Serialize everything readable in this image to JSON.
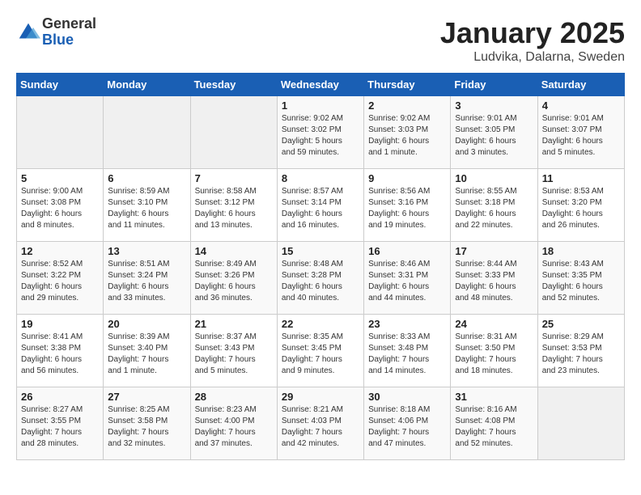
{
  "app": {
    "name_general": "General",
    "name_blue": "Blue"
  },
  "calendar": {
    "title": "January 2025",
    "subtitle": "Ludvika, Dalarna, Sweden"
  },
  "headers": [
    "Sunday",
    "Monday",
    "Tuesday",
    "Wednesday",
    "Thursday",
    "Friday",
    "Saturday"
  ],
  "weeks": [
    [
      {
        "day": "",
        "info": ""
      },
      {
        "day": "",
        "info": ""
      },
      {
        "day": "",
        "info": ""
      },
      {
        "day": "1",
        "info": "Sunrise: 9:02 AM\nSunset: 3:02 PM\nDaylight: 5 hours\nand 59 minutes."
      },
      {
        "day": "2",
        "info": "Sunrise: 9:02 AM\nSunset: 3:03 PM\nDaylight: 6 hours\nand 1 minute."
      },
      {
        "day": "3",
        "info": "Sunrise: 9:01 AM\nSunset: 3:05 PM\nDaylight: 6 hours\nand 3 minutes."
      },
      {
        "day": "4",
        "info": "Sunrise: 9:01 AM\nSunset: 3:07 PM\nDaylight: 6 hours\nand 5 minutes."
      }
    ],
    [
      {
        "day": "5",
        "info": "Sunrise: 9:00 AM\nSunset: 3:08 PM\nDaylight: 6 hours\nand 8 minutes."
      },
      {
        "day": "6",
        "info": "Sunrise: 8:59 AM\nSunset: 3:10 PM\nDaylight: 6 hours\nand 11 minutes."
      },
      {
        "day": "7",
        "info": "Sunrise: 8:58 AM\nSunset: 3:12 PM\nDaylight: 6 hours\nand 13 minutes."
      },
      {
        "day": "8",
        "info": "Sunrise: 8:57 AM\nSunset: 3:14 PM\nDaylight: 6 hours\nand 16 minutes."
      },
      {
        "day": "9",
        "info": "Sunrise: 8:56 AM\nSunset: 3:16 PM\nDaylight: 6 hours\nand 19 minutes."
      },
      {
        "day": "10",
        "info": "Sunrise: 8:55 AM\nSunset: 3:18 PM\nDaylight: 6 hours\nand 22 minutes."
      },
      {
        "day": "11",
        "info": "Sunrise: 8:53 AM\nSunset: 3:20 PM\nDaylight: 6 hours\nand 26 minutes."
      }
    ],
    [
      {
        "day": "12",
        "info": "Sunrise: 8:52 AM\nSunset: 3:22 PM\nDaylight: 6 hours\nand 29 minutes."
      },
      {
        "day": "13",
        "info": "Sunrise: 8:51 AM\nSunset: 3:24 PM\nDaylight: 6 hours\nand 33 minutes."
      },
      {
        "day": "14",
        "info": "Sunrise: 8:49 AM\nSunset: 3:26 PM\nDaylight: 6 hours\nand 36 minutes."
      },
      {
        "day": "15",
        "info": "Sunrise: 8:48 AM\nSunset: 3:28 PM\nDaylight: 6 hours\nand 40 minutes."
      },
      {
        "day": "16",
        "info": "Sunrise: 8:46 AM\nSunset: 3:31 PM\nDaylight: 6 hours\nand 44 minutes."
      },
      {
        "day": "17",
        "info": "Sunrise: 8:44 AM\nSunset: 3:33 PM\nDaylight: 6 hours\nand 48 minutes."
      },
      {
        "day": "18",
        "info": "Sunrise: 8:43 AM\nSunset: 3:35 PM\nDaylight: 6 hours\nand 52 minutes."
      }
    ],
    [
      {
        "day": "19",
        "info": "Sunrise: 8:41 AM\nSunset: 3:38 PM\nDaylight: 6 hours\nand 56 minutes."
      },
      {
        "day": "20",
        "info": "Sunrise: 8:39 AM\nSunset: 3:40 PM\nDaylight: 7 hours\nand 1 minute."
      },
      {
        "day": "21",
        "info": "Sunrise: 8:37 AM\nSunset: 3:43 PM\nDaylight: 7 hours\nand 5 minutes."
      },
      {
        "day": "22",
        "info": "Sunrise: 8:35 AM\nSunset: 3:45 PM\nDaylight: 7 hours\nand 9 minutes."
      },
      {
        "day": "23",
        "info": "Sunrise: 8:33 AM\nSunset: 3:48 PM\nDaylight: 7 hours\nand 14 minutes."
      },
      {
        "day": "24",
        "info": "Sunrise: 8:31 AM\nSunset: 3:50 PM\nDaylight: 7 hours\nand 18 minutes."
      },
      {
        "day": "25",
        "info": "Sunrise: 8:29 AM\nSunset: 3:53 PM\nDaylight: 7 hours\nand 23 minutes."
      }
    ],
    [
      {
        "day": "26",
        "info": "Sunrise: 8:27 AM\nSunset: 3:55 PM\nDaylight: 7 hours\nand 28 minutes."
      },
      {
        "day": "27",
        "info": "Sunrise: 8:25 AM\nSunset: 3:58 PM\nDaylight: 7 hours\nand 32 minutes."
      },
      {
        "day": "28",
        "info": "Sunrise: 8:23 AM\nSunset: 4:00 PM\nDaylight: 7 hours\nand 37 minutes."
      },
      {
        "day": "29",
        "info": "Sunrise: 8:21 AM\nSunset: 4:03 PM\nDaylight: 7 hours\nand 42 minutes."
      },
      {
        "day": "30",
        "info": "Sunrise: 8:18 AM\nSunset: 4:06 PM\nDaylight: 7 hours\nand 47 minutes."
      },
      {
        "day": "31",
        "info": "Sunrise: 8:16 AM\nSunset: 4:08 PM\nDaylight: 7 hours\nand 52 minutes."
      },
      {
        "day": "",
        "info": ""
      }
    ]
  ]
}
